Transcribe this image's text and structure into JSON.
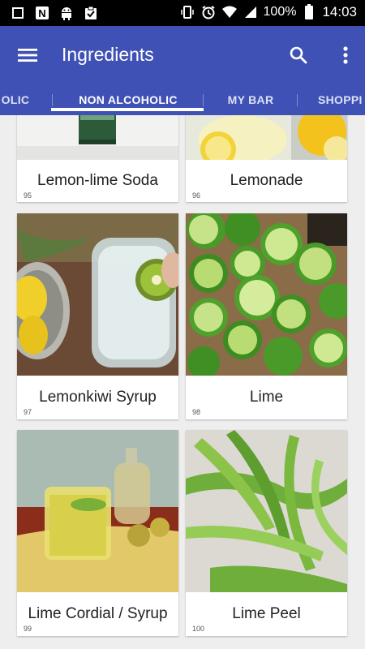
{
  "status_bar": {
    "battery": "100%",
    "time": "14:03"
  },
  "app_bar": {
    "title": "Ingredients"
  },
  "tabs": [
    {
      "label": "OLIC"
    },
    {
      "label": "NON ALCOHOLIC",
      "selected": true
    },
    {
      "label": "MY BAR"
    },
    {
      "label": "SHOPPI"
    }
  ],
  "ingredients": [
    {
      "name": "Lemon-lime Soda",
      "number": "95"
    },
    {
      "name": "Lemonade",
      "number": "96"
    },
    {
      "name": "Lemonkiwi Syrup",
      "number": "97"
    },
    {
      "name": "Lime",
      "number": "98"
    },
    {
      "name": "Lime Cordial / Syrup",
      "number": "99"
    },
    {
      "name": "Lime Peel",
      "number": "100"
    }
  ],
  "colors": {
    "primary": "#3f51b5",
    "status_bar": "#000000",
    "background": "#eeeeee"
  }
}
